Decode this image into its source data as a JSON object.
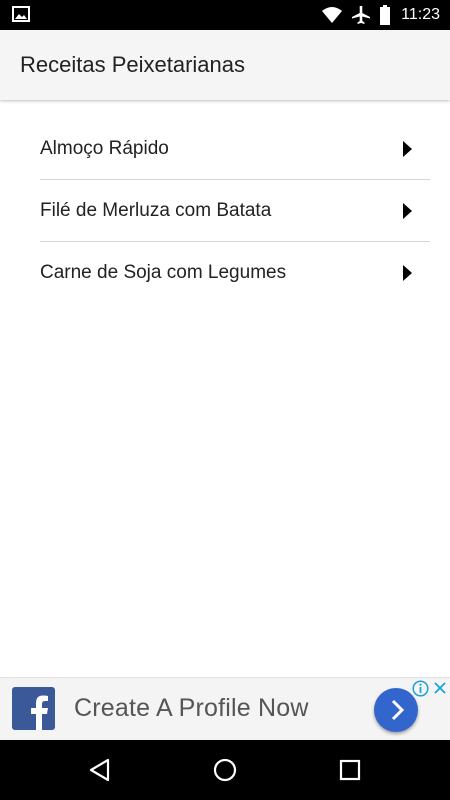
{
  "status_bar": {
    "time": "11:23",
    "icons": [
      "image-icon",
      "wifi-icon",
      "airplane-icon",
      "battery-icon"
    ]
  },
  "app_bar": {
    "title": "Receitas Peixetarianas"
  },
  "list": {
    "items": [
      {
        "label": "Almoço Rápido",
        "icon": "chevron-right-icon"
      },
      {
        "label": "Filé de Merluza com Batata",
        "icon": "chevron-right-icon"
      },
      {
        "label": "Carne de Soja com Legumes",
        "icon": "chevron-right-icon"
      }
    ]
  },
  "ad": {
    "text": "Create A Profile Now",
    "logo": "facebook-logo",
    "colors": {
      "brand": "#3b5998",
      "button": "#3366cc"
    }
  },
  "nav_bar": {
    "buttons": [
      "back-icon",
      "home-icon",
      "recents-icon"
    ]
  }
}
